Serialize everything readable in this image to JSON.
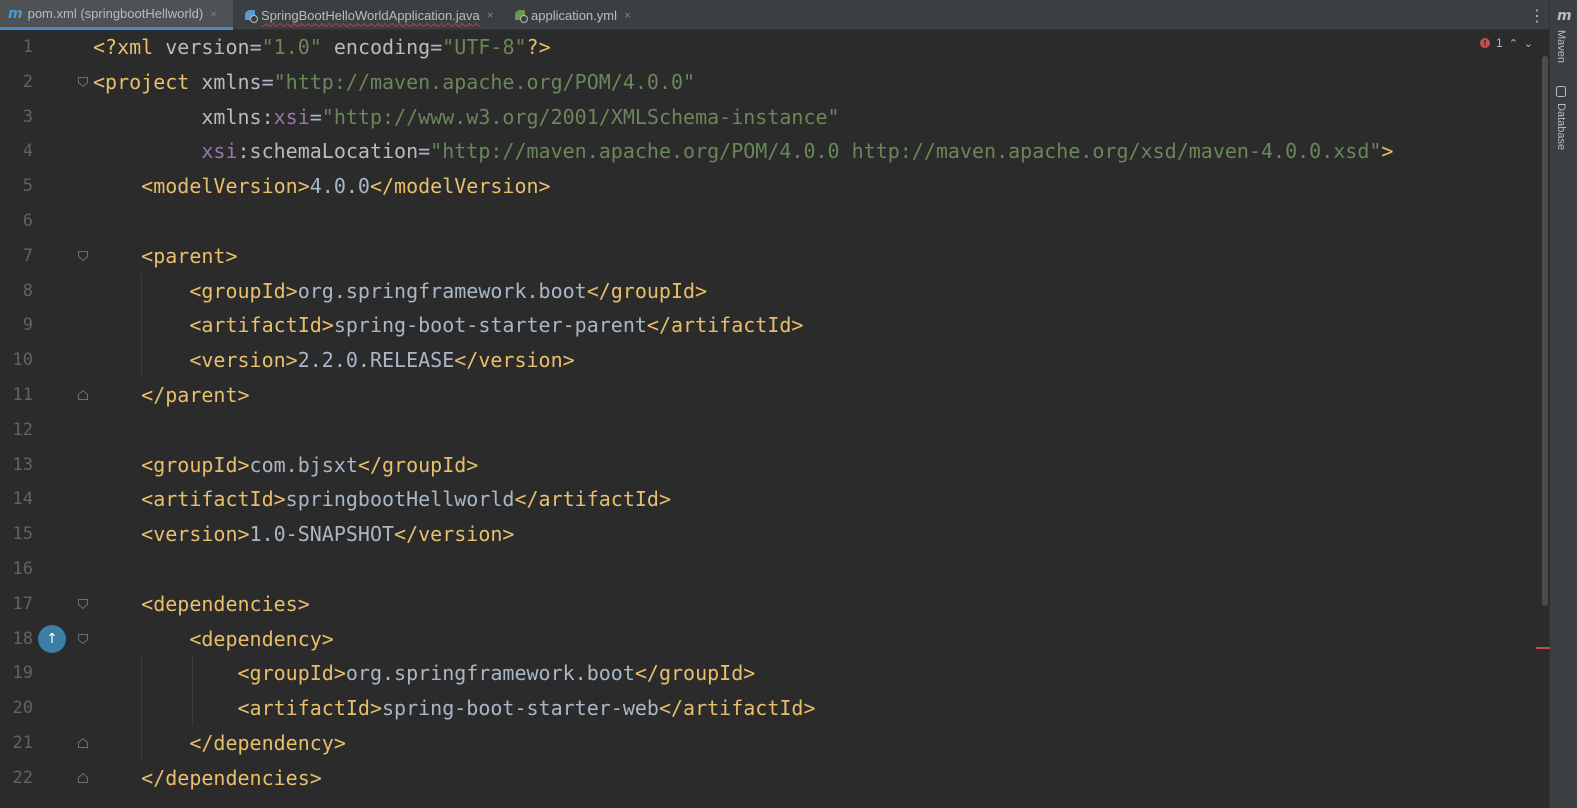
{
  "tabs": [
    {
      "icon": "maven-m-icon",
      "label": "pom.xml (springbootHellworld)",
      "active": true
    },
    {
      "icon": "spring-class-icon",
      "label": "SpringBootHelloWorldApplication.java",
      "active": false
    },
    {
      "icon": "spring-config-icon",
      "label": "application.yml",
      "active": false
    }
  ],
  "tab_close_glyph": "×",
  "right_toolbar": {
    "maven_icon_glyph": "m",
    "maven_label": "Maven",
    "database_label": "Database"
  },
  "inspections": {
    "error_count": "1"
  },
  "colors": {
    "background": "#2b2b2b",
    "tag": "#e8bf6a",
    "attribute": "#bababa",
    "namespace": "#9876aa",
    "string": "#6a8759",
    "text": "#a9b7c6",
    "line_number": "#606366"
  },
  "editor": {
    "lines": [
      {
        "n": "1",
        "tokens": [
          [
            "pi",
            "<?"
          ],
          [
            "tag",
            "xml "
          ],
          [
            "attr",
            "version"
          ],
          [
            "text",
            "="
          ],
          [
            "val",
            "\"1.0\""
          ],
          [
            "attr",
            " encoding"
          ],
          [
            "text",
            "="
          ],
          [
            "val",
            "\"UTF-8\""
          ],
          [
            "pi",
            "?>"
          ]
        ]
      },
      {
        "n": "2",
        "tokens": [
          [
            "tag",
            "<project "
          ],
          [
            "attr",
            "xmlns"
          ],
          [
            "text",
            "="
          ],
          [
            "val",
            "\"http://maven.apache.org/POM/4.0.0\""
          ]
        ]
      },
      {
        "n": "3",
        "tokens": [
          [
            "text",
            "         "
          ],
          [
            "attr",
            "xmlns:"
          ],
          [
            "ns",
            "xsi"
          ],
          [
            "text",
            "="
          ],
          [
            "val",
            "\"http://www.w3.org/2001/XMLSchema-instance\""
          ]
        ]
      },
      {
        "n": "4",
        "tokens": [
          [
            "text",
            "         "
          ],
          [
            "ns",
            "xsi"
          ],
          [
            "attr",
            ":schemaLocation"
          ],
          [
            "text",
            "="
          ],
          [
            "val",
            "\"http://maven.apache.org/POM/4.0.0 http://maven.apache.org/xsd/maven-4.0.0.xsd\""
          ],
          [
            "tag",
            ">"
          ]
        ]
      },
      {
        "n": "5",
        "tokens": [
          [
            "text",
            "    "
          ],
          [
            "tag",
            "<modelVersion>"
          ],
          [
            "text",
            "4.0.0"
          ],
          [
            "tag",
            "</modelVersion>"
          ]
        ]
      },
      {
        "n": "6",
        "tokens": []
      },
      {
        "n": "7",
        "tokens": [
          [
            "text",
            "    "
          ],
          [
            "tag",
            "<parent>"
          ]
        ]
      },
      {
        "n": "8",
        "tokens": [
          [
            "text",
            "        "
          ],
          [
            "tag",
            "<groupId>"
          ],
          [
            "text",
            "org.springframework.boot"
          ],
          [
            "tag",
            "</groupId>"
          ]
        ]
      },
      {
        "n": "9",
        "tokens": [
          [
            "text",
            "        "
          ],
          [
            "tag",
            "<artifactId>"
          ],
          [
            "text",
            "spring-boot-starter-parent"
          ],
          [
            "tag",
            "</artifactId>"
          ]
        ]
      },
      {
        "n": "10",
        "tokens": [
          [
            "text",
            "        "
          ],
          [
            "tag",
            "<version>"
          ],
          [
            "text",
            "2.2.0.RELEASE"
          ],
          [
            "tag",
            "</version>"
          ]
        ]
      },
      {
        "n": "11",
        "tokens": [
          [
            "text",
            "    "
          ],
          [
            "tag",
            "</parent>"
          ]
        ]
      },
      {
        "n": "12",
        "tokens": []
      },
      {
        "n": "13",
        "tokens": [
          [
            "text",
            "    "
          ],
          [
            "tag",
            "<groupId>"
          ],
          [
            "text",
            "com.bjsxt"
          ],
          [
            "tag",
            "</groupId>"
          ]
        ]
      },
      {
        "n": "14",
        "tokens": [
          [
            "text",
            "    "
          ],
          [
            "tag",
            "<artifactId>"
          ],
          [
            "text",
            "springbootHellworld"
          ],
          [
            "tag",
            "</artifactId>"
          ]
        ]
      },
      {
        "n": "15",
        "tokens": [
          [
            "text",
            "    "
          ],
          [
            "tag",
            "<version>"
          ],
          [
            "text",
            "1.0-SNAPSHOT"
          ],
          [
            "tag",
            "</version>"
          ]
        ]
      },
      {
        "n": "16",
        "tokens": []
      },
      {
        "n": "17",
        "tokens": [
          [
            "text",
            "    "
          ],
          [
            "tag",
            "<dependencies>"
          ]
        ]
      },
      {
        "n": "18",
        "tokens": [
          [
            "text",
            "        "
          ],
          [
            "tag",
            "<dependency>"
          ]
        ]
      },
      {
        "n": "19",
        "tokens": [
          [
            "text",
            "            "
          ],
          [
            "tag",
            "<groupId>"
          ],
          [
            "text",
            "org.springframework.boot"
          ],
          [
            "tag",
            "</groupId>"
          ]
        ]
      },
      {
        "n": "20",
        "tokens": [
          [
            "text",
            "            "
          ],
          [
            "tag",
            "<artifactId>"
          ],
          [
            "text",
            "spring-boot-starter-web"
          ],
          [
            "tag",
            "</artifactId>"
          ]
        ]
      },
      {
        "n": "21",
        "tokens": [
          [
            "text",
            "        "
          ],
          [
            "tag",
            "</dependency>"
          ]
        ]
      },
      {
        "n": "22",
        "tokens": [
          [
            "text",
            "    "
          ],
          [
            "tag",
            "</dependencies>"
          ]
        ]
      }
    ]
  }
}
